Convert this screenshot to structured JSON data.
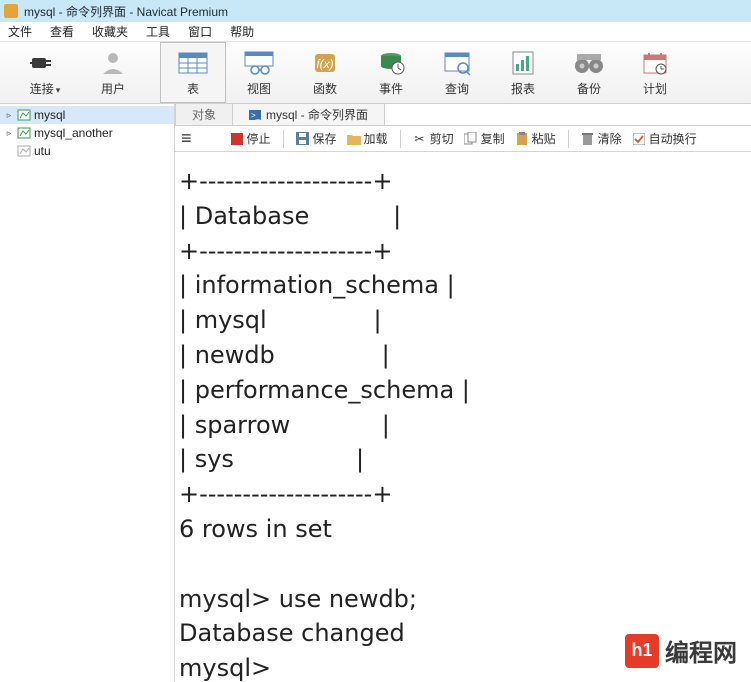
{
  "title": "mysql - 命令列界面 - Navicat Premium",
  "menu": {
    "items": [
      "文件",
      "查看",
      "收藏夹",
      "工具",
      "窗口",
      "帮助"
    ]
  },
  "main_toolbar": [
    {
      "label": "连接",
      "icon": "plug",
      "dropdown": true
    },
    {
      "label": "用户",
      "icon": "user",
      "dropdown": false
    },
    {
      "label": "表",
      "icon": "table",
      "dropdown": false,
      "selected": true
    },
    {
      "label": "视图",
      "icon": "view",
      "dropdown": false
    },
    {
      "label": "函数",
      "icon": "fx",
      "dropdown": false
    },
    {
      "label": "事件",
      "icon": "event",
      "dropdown": false
    },
    {
      "label": "查询",
      "icon": "query",
      "dropdown": false
    },
    {
      "label": "报表",
      "icon": "report",
      "dropdown": false
    },
    {
      "label": "备份",
      "icon": "backup",
      "dropdown": false
    },
    {
      "label": "计划",
      "icon": "schedule",
      "dropdown": false
    }
  ],
  "sidebar": {
    "items": [
      {
        "label": "mysql",
        "open": true,
        "selected": true
      },
      {
        "label": "mysql_another",
        "open": true,
        "selected": false
      },
      {
        "label": "utu",
        "open": false,
        "selected": false
      }
    ]
  },
  "tabs": {
    "items": [
      {
        "label": "对象",
        "active": false
      },
      {
        "label": "mysql - 命令列界面",
        "active": true
      }
    ]
  },
  "sub_toolbar": {
    "hamburger": "≡",
    "items": {
      "stop": {
        "label": "停止",
        "color": "#d0342c"
      },
      "save": {
        "label": "保存"
      },
      "load": {
        "label": "加载"
      },
      "cut": {
        "label": "剪切"
      },
      "copy": {
        "label": "复制"
      },
      "paste": {
        "label": "粘贴"
      },
      "clear": {
        "label": "清除"
      },
      "wrap": {
        "label": "自动换行",
        "checked": true
      }
    }
  },
  "terminal_lines": [
    "+--------------------+",
    "| Database           |",
    "+--------------------+",
    "| information_schema |",
    "| mysql              |",
    "| newdb              |",
    "| performance_schema |",
    "| sparrow            |",
    "| sys                |",
    "+--------------------+",
    "6 rows in set",
    "",
    "mysql> use newdb;",
    "Database changed",
    "mysql>"
  ],
  "watermark": {
    "box": "h1",
    "text": "编程网"
  }
}
